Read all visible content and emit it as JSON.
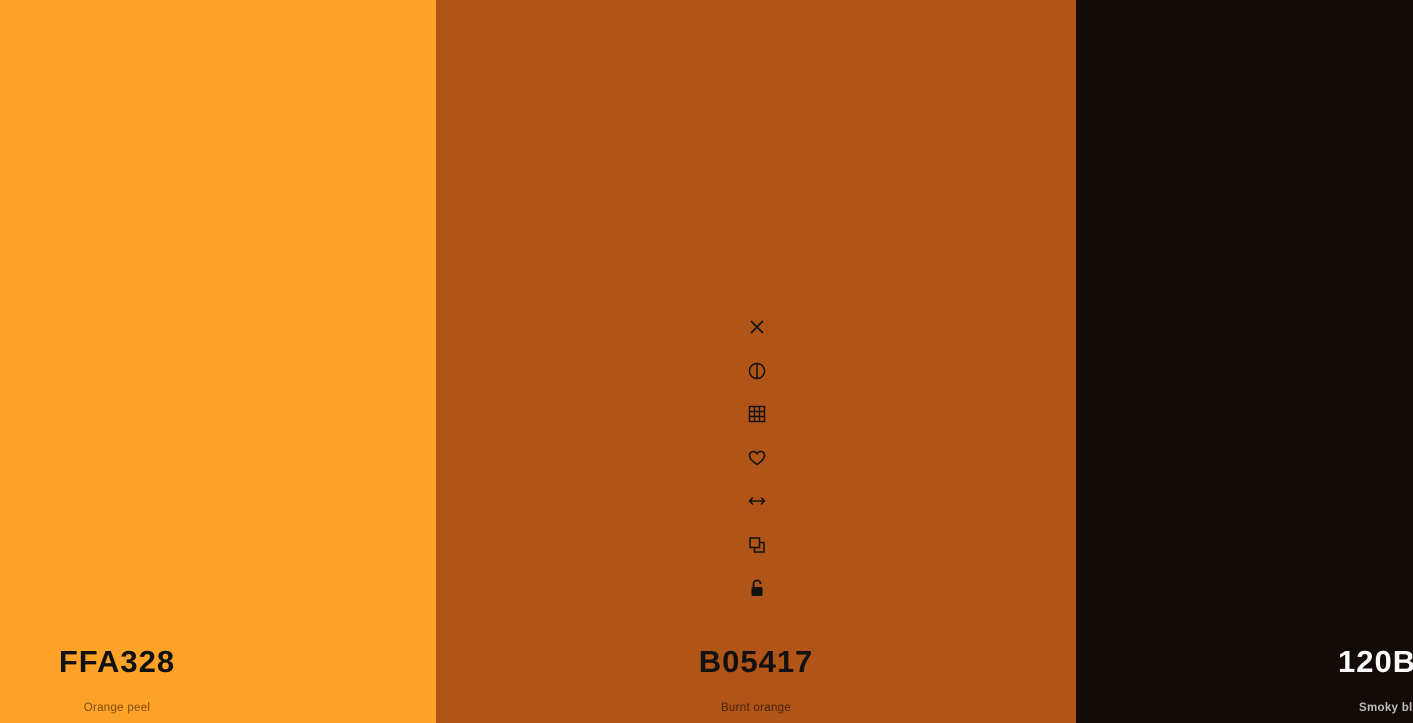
{
  "palette": {
    "swatches": [
      {
        "hex": "FFA328",
        "name": "Orange peel",
        "color": "#FFA328"
      },
      {
        "hex": "B05417",
        "name": "Burnt orange",
        "color": "#B05417"
      },
      {
        "hex": "120B",
        "name": "Smoky bl",
        "color": "#120B08"
      }
    ],
    "toolbar_icons": [
      "close-icon",
      "contrast-icon",
      "grid-icon",
      "heart-icon",
      "drag-horizontal-icon",
      "copy-icon",
      "unlock-icon"
    ]
  }
}
